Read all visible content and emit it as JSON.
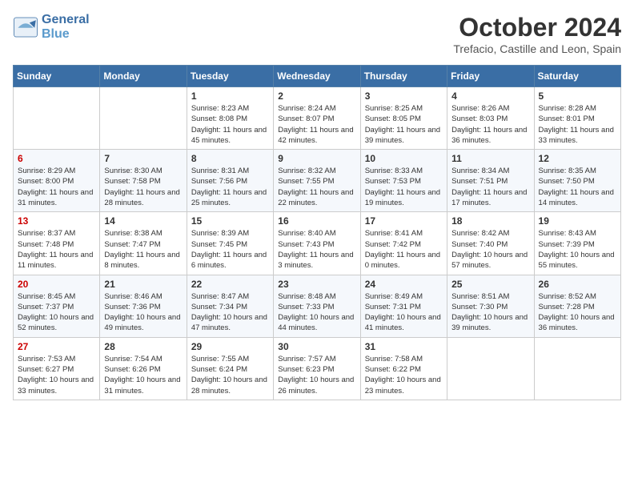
{
  "header": {
    "logo_line1": "General",
    "logo_line2": "Blue",
    "month": "October 2024",
    "location": "Trefacio, Castille and Leon, Spain"
  },
  "weekdays": [
    "Sunday",
    "Monday",
    "Tuesday",
    "Wednesday",
    "Thursday",
    "Friday",
    "Saturday"
  ],
  "weeks": [
    [
      {
        "day": "",
        "content": ""
      },
      {
        "day": "",
        "content": ""
      },
      {
        "day": "1",
        "content": "Sunrise: 8:23 AM\nSunset: 8:08 PM\nDaylight: 11 hours and 45 minutes."
      },
      {
        "day": "2",
        "content": "Sunrise: 8:24 AM\nSunset: 8:07 PM\nDaylight: 11 hours and 42 minutes."
      },
      {
        "day": "3",
        "content": "Sunrise: 8:25 AM\nSunset: 8:05 PM\nDaylight: 11 hours and 39 minutes."
      },
      {
        "day": "4",
        "content": "Sunrise: 8:26 AM\nSunset: 8:03 PM\nDaylight: 11 hours and 36 minutes."
      },
      {
        "day": "5",
        "content": "Sunrise: 8:28 AM\nSunset: 8:01 PM\nDaylight: 11 hours and 33 minutes."
      }
    ],
    [
      {
        "day": "6",
        "content": "Sunrise: 8:29 AM\nSunset: 8:00 PM\nDaylight: 11 hours and 31 minutes."
      },
      {
        "day": "7",
        "content": "Sunrise: 8:30 AM\nSunset: 7:58 PM\nDaylight: 11 hours and 28 minutes."
      },
      {
        "day": "8",
        "content": "Sunrise: 8:31 AM\nSunset: 7:56 PM\nDaylight: 11 hours and 25 minutes."
      },
      {
        "day": "9",
        "content": "Sunrise: 8:32 AM\nSunset: 7:55 PM\nDaylight: 11 hours and 22 minutes."
      },
      {
        "day": "10",
        "content": "Sunrise: 8:33 AM\nSunset: 7:53 PM\nDaylight: 11 hours and 19 minutes."
      },
      {
        "day": "11",
        "content": "Sunrise: 8:34 AM\nSunset: 7:51 PM\nDaylight: 11 hours and 17 minutes."
      },
      {
        "day": "12",
        "content": "Sunrise: 8:35 AM\nSunset: 7:50 PM\nDaylight: 11 hours and 14 minutes."
      }
    ],
    [
      {
        "day": "13",
        "content": "Sunrise: 8:37 AM\nSunset: 7:48 PM\nDaylight: 11 hours and 11 minutes."
      },
      {
        "day": "14",
        "content": "Sunrise: 8:38 AM\nSunset: 7:47 PM\nDaylight: 11 hours and 8 minutes."
      },
      {
        "day": "15",
        "content": "Sunrise: 8:39 AM\nSunset: 7:45 PM\nDaylight: 11 hours and 6 minutes."
      },
      {
        "day": "16",
        "content": "Sunrise: 8:40 AM\nSunset: 7:43 PM\nDaylight: 11 hours and 3 minutes."
      },
      {
        "day": "17",
        "content": "Sunrise: 8:41 AM\nSunset: 7:42 PM\nDaylight: 11 hours and 0 minutes."
      },
      {
        "day": "18",
        "content": "Sunrise: 8:42 AM\nSunset: 7:40 PM\nDaylight: 10 hours and 57 minutes."
      },
      {
        "day": "19",
        "content": "Sunrise: 8:43 AM\nSunset: 7:39 PM\nDaylight: 10 hours and 55 minutes."
      }
    ],
    [
      {
        "day": "20",
        "content": "Sunrise: 8:45 AM\nSunset: 7:37 PM\nDaylight: 10 hours and 52 minutes."
      },
      {
        "day": "21",
        "content": "Sunrise: 8:46 AM\nSunset: 7:36 PM\nDaylight: 10 hours and 49 minutes."
      },
      {
        "day": "22",
        "content": "Sunrise: 8:47 AM\nSunset: 7:34 PM\nDaylight: 10 hours and 47 minutes."
      },
      {
        "day": "23",
        "content": "Sunrise: 8:48 AM\nSunset: 7:33 PM\nDaylight: 10 hours and 44 minutes."
      },
      {
        "day": "24",
        "content": "Sunrise: 8:49 AM\nSunset: 7:31 PM\nDaylight: 10 hours and 41 minutes."
      },
      {
        "day": "25",
        "content": "Sunrise: 8:51 AM\nSunset: 7:30 PM\nDaylight: 10 hours and 39 minutes."
      },
      {
        "day": "26",
        "content": "Sunrise: 8:52 AM\nSunset: 7:28 PM\nDaylight: 10 hours and 36 minutes."
      }
    ],
    [
      {
        "day": "27",
        "content": "Sunrise: 7:53 AM\nSunset: 6:27 PM\nDaylight: 10 hours and 33 minutes."
      },
      {
        "day": "28",
        "content": "Sunrise: 7:54 AM\nSunset: 6:26 PM\nDaylight: 10 hours and 31 minutes."
      },
      {
        "day": "29",
        "content": "Sunrise: 7:55 AM\nSunset: 6:24 PM\nDaylight: 10 hours and 28 minutes."
      },
      {
        "day": "30",
        "content": "Sunrise: 7:57 AM\nSunset: 6:23 PM\nDaylight: 10 hours and 26 minutes."
      },
      {
        "day": "31",
        "content": "Sunrise: 7:58 AM\nSunset: 6:22 PM\nDaylight: 10 hours and 23 minutes."
      },
      {
        "day": "",
        "content": ""
      },
      {
        "day": "",
        "content": ""
      }
    ]
  ]
}
